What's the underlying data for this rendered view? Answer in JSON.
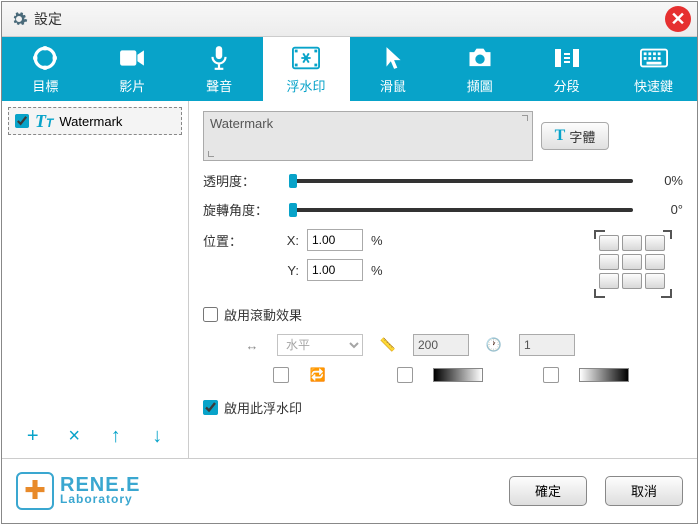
{
  "window": {
    "title": "設定"
  },
  "tabs": [
    {
      "label": "目標"
    },
    {
      "label": "影片"
    },
    {
      "label": "聲音"
    },
    {
      "label": "浮水印",
      "active": true
    },
    {
      "label": "滑鼠"
    },
    {
      "label": "擷圖"
    },
    {
      "label": "分段"
    },
    {
      "label": "快速鍵"
    }
  ],
  "sidebar": {
    "items": [
      {
        "label": "Watermark",
        "checked": true
      }
    ]
  },
  "panel": {
    "text_value": "Watermark",
    "font_btn": "字體",
    "opacity_label": "透明度：",
    "opacity_value": "0%",
    "rotation_label": "旋轉角度：",
    "rotation_value": "0°",
    "position_label": "位置：",
    "x_label": "X:",
    "x_value": "1.00",
    "y_label": "Y:",
    "y_value": "1.00",
    "percent": "%",
    "scroll_effect": "啟用滾動效果",
    "direction_value": "水平",
    "ruler_value": "200",
    "clock_value": "1",
    "enable_watermark": "啟用此浮水印"
  },
  "footer": {
    "brand_top": "RENE.E",
    "brand_bottom": "Laboratory",
    "ok": "確定",
    "cancel": "取消"
  }
}
